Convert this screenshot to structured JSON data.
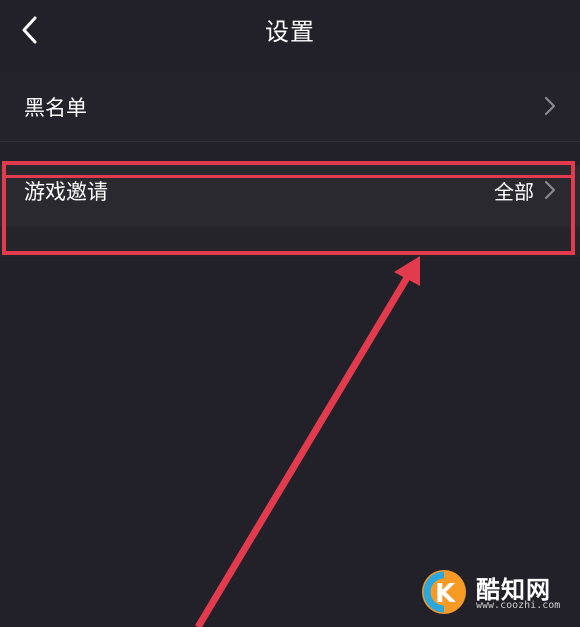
{
  "header": {
    "title": "设置",
    "back_icon": "chevron-left-icon"
  },
  "settings": {
    "items": [
      {
        "label": "黑名单",
        "value": "",
        "icon": "chevron-right-icon"
      },
      {
        "label": "游戏邀请",
        "value": "全部",
        "icon": "chevron-right-icon"
      }
    ]
  },
  "annotation": {
    "highlight_color": "#e23b4e",
    "arrow_color": "#e23b4e"
  },
  "watermark": {
    "name": "酷知网",
    "url": "www.coozhi.com"
  },
  "colors": {
    "background": "#22212a",
    "text": "#ffffff"
  }
}
